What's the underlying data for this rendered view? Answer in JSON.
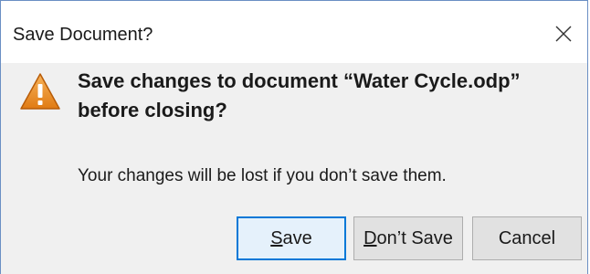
{
  "dialog": {
    "title": "Save Document?",
    "headline": "Save changes to document “Water Cycle.odp” before closing?",
    "message": "Your changes will be lost if you don’t save them.",
    "icon": "warning-icon",
    "accent_color": "#0078d7",
    "buttons": {
      "save": {
        "mnemonic": "S",
        "rest": "ave"
      },
      "dont_save": {
        "mnemonic": "D",
        "rest": "on’t Save"
      },
      "cancel": {
        "label": "Cancel"
      }
    }
  }
}
